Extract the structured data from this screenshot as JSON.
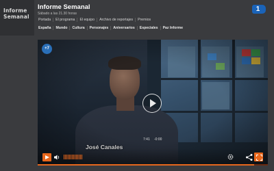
{
  "header": {
    "logo_line1": "Informe",
    "logo_line2": "Semanal",
    "title": "Informe Semanal",
    "subtitle": "Sábado a las 21.30 horas",
    "channel_number": "1",
    "nav_primary": [
      "Portada",
      "El programa",
      "El equipo",
      "Archivo de reportajes",
      "Premios"
    ],
    "nav_secondary": [
      "España",
      "Mundo",
      "Cultura",
      "Personajes",
      "Aniversarios",
      "Especiales",
      "Paz Informe"
    ]
  },
  "video": {
    "age_badge": "+7",
    "lower_third_name": "José Canales",
    "current_time": "7:41",
    "remaining_time": "-0:00",
    "progress_fraction": 0.94,
    "volume_level": 1.0
  },
  "colors": {
    "accent": "#e8671c",
    "channel_blue": "#1a63b8",
    "badge_blue": "#2a6fb8"
  },
  "icons": {
    "play": "play-icon",
    "volume": "volume-icon",
    "settings": "settings-icon",
    "share": "share-icon",
    "fullscreen": "fullscreen-icon"
  }
}
